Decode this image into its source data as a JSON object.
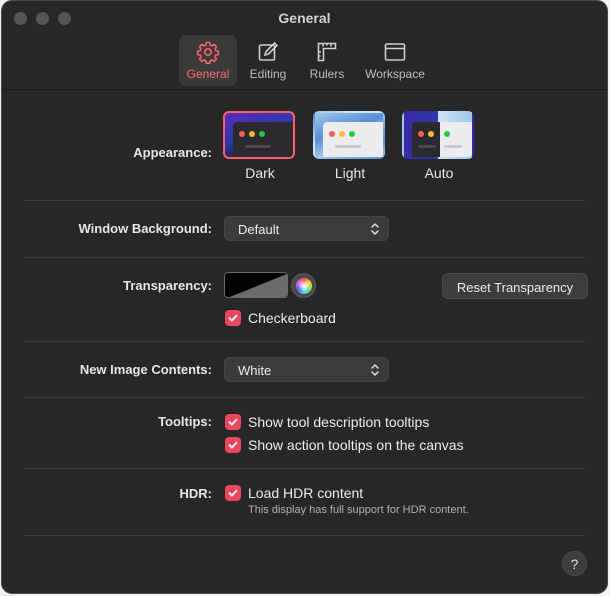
{
  "window": {
    "title": "General"
  },
  "toolbar": {
    "tabs": [
      {
        "label": "General",
        "icon": "gear-icon",
        "active": true
      },
      {
        "label": "Editing",
        "icon": "edit-icon",
        "active": false
      },
      {
        "label": "Rulers",
        "icon": "rulers-icon",
        "active": false
      },
      {
        "label": "Workspace",
        "icon": "workspace-icon",
        "active": false
      }
    ]
  },
  "appearance": {
    "label": "Appearance:",
    "options": [
      {
        "label": "Dark",
        "selected": true
      },
      {
        "label": "Light",
        "selected": false
      },
      {
        "label": "Auto",
        "selected": false
      }
    ]
  },
  "window_background": {
    "label": "Window Background:",
    "value": "Default"
  },
  "transparency": {
    "label": "Transparency:",
    "reset_label": "Reset Transparency",
    "checkerboard_label": "Checkerboard",
    "checkerboard_checked": true
  },
  "new_image_contents": {
    "label": "New Image Contents:",
    "value": "White"
  },
  "tooltips": {
    "label": "Tooltips:",
    "options": [
      {
        "label": "Show tool description tooltips",
        "checked": true
      },
      {
        "label": "Show action tooltips on the canvas",
        "checked": true
      }
    ]
  },
  "hdr": {
    "label": "HDR:",
    "option_label": "Load HDR content",
    "checked": true,
    "note": "This display has full support for HDR content."
  },
  "help": {
    "label": "?"
  },
  "colors": {
    "accent": "#e9485f",
    "window_bg": "#272727",
    "active_tab_text": "#ff6b6b"
  }
}
